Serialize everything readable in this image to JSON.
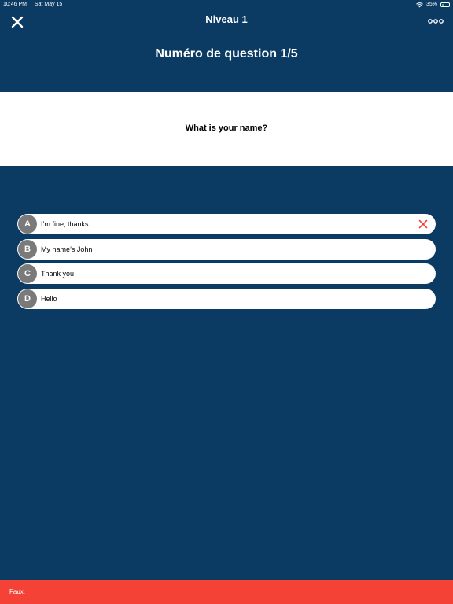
{
  "status_bar": {
    "time": "10:46 PM",
    "date": "Sat May 15",
    "battery": "35%",
    "battery_level": 0.35,
    "icons": [
      "wifi-icon",
      "battery-icon"
    ]
  },
  "nav": {
    "title": "Niveau 1",
    "close_icon": "close-icon",
    "more_icon": "more-icon"
  },
  "question_number": "Numéro de question 1/5",
  "question": {
    "text": "What is your name?"
  },
  "answers": [
    {
      "letter": "A",
      "text": "I’m fine, thanks",
      "state": "wrong"
    },
    {
      "letter": "B",
      "text": "My name’s John",
      "state": "default"
    },
    {
      "letter": "C",
      "text": "Thank you",
      "state": "default"
    },
    {
      "letter": "D",
      "text": "Hello",
      "state": "default"
    }
  ],
  "feedback": {
    "text": "Faux."
  },
  "colors": {
    "background": "#0b3a63",
    "card": "#ffffff",
    "letter_circle": "#7a7a7a",
    "wrong": "#f44336",
    "battery": "#3ccf4e"
  }
}
